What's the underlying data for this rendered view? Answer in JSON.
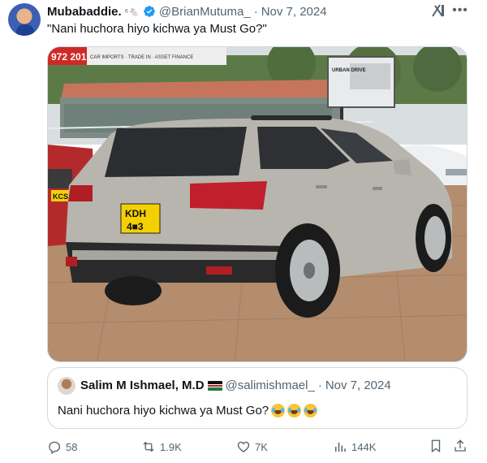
{
  "tweet": {
    "display_name": "Mubabaddie.",
    "name_suffix": "⁶🐁",
    "handle": "@BrianMutuma_",
    "separator": "·",
    "date": "Nov 7, 2024",
    "text": "\"Nani huchora hiyo kichwa ya Must Go?\""
  },
  "photo": {
    "plate_line1": "KDH",
    "plate_line2": "4■3",
    "left_plate": "KCS",
    "banner_text": "972 201",
    "banner_sub": "CAR IMPORTS · TRADE IN · ASSET FINANCE",
    "billboard_text": "URBAN DRIVE",
    "colors": {
      "car": "#b7b5ae",
      "paving": "#b38d6e",
      "sky": "#dfe3e4",
      "plate": "#f5d000"
    }
  },
  "quote": {
    "display_name": "Salim M Ishmael, M.D",
    "handle": "@salimishmael_",
    "separator": "·",
    "date": "Nov 7, 2024",
    "text": "Nani huchora hiyo kichwa ya Must Go?",
    "emoji_count": 3
  },
  "actions": {
    "replies": "58",
    "reposts": "1.9K",
    "likes": "7K",
    "views": "144K"
  },
  "colors": {
    "accent": "#1d9bf0",
    "muted": "#536471",
    "border": "#cfd9de"
  }
}
